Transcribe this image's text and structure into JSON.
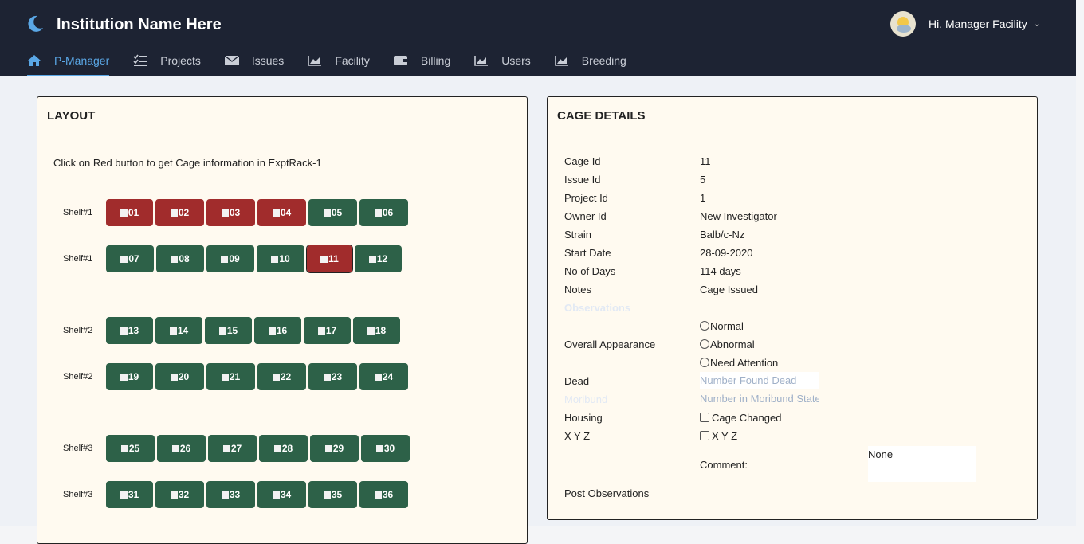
{
  "header": {
    "brand": "Institution Name Here",
    "greeting": "Hi, Manager Facility",
    "nav": [
      {
        "label": "P-Manager",
        "icon": "home-icon"
      },
      {
        "label": "Projects",
        "icon": "tasks-icon"
      },
      {
        "label": "Issues",
        "icon": "envelope-icon"
      },
      {
        "label": "Facility",
        "icon": "chart-icon"
      },
      {
        "label": "Billing",
        "icon": "wallet-icon"
      },
      {
        "label": "Users",
        "icon": "chart-icon"
      },
      {
        "label": "Breeding",
        "icon": "chart-icon"
      }
    ]
  },
  "layout": {
    "title": "LAYOUT",
    "hint": "Click on Red button to get Cage information in ExptRack-1",
    "shelves": [
      {
        "label": "Shelf#1",
        "cages": [
          [
            "01",
            "red"
          ],
          [
            "02",
            "red"
          ],
          [
            "03",
            "red"
          ],
          [
            "04",
            "red"
          ],
          [
            "05",
            "green"
          ],
          [
            "06",
            "green"
          ]
        ]
      },
      {
        "label": "Shelf#1",
        "cages": [
          [
            "07",
            "green"
          ],
          [
            "08",
            "green"
          ],
          [
            "09",
            "green"
          ],
          [
            "10",
            "green"
          ],
          [
            "11",
            "red"
          ],
          [
            "12",
            "green"
          ]
        ]
      },
      {
        "label": "Shelf#2",
        "cages": [
          [
            "13",
            "green"
          ],
          [
            "14",
            "green"
          ],
          [
            "15",
            "green"
          ],
          [
            "16",
            "green"
          ],
          [
            "17",
            "green"
          ],
          [
            "18",
            "green"
          ]
        ]
      },
      {
        "label": "Shelf#2",
        "cages": [
          [
            "19",
            "green"
          ],
          [
            "20",
            "green"
          ],
          [
            "21",
            "green"
          ],
          [
            "22",
            "green"
          ],
          [
            "23",
            "green"
          ],
          [
            "24",
            "green"
          ]
        ]
      },
      {
        "label": "Shelf#3",
        "cages": [
          [
            "25",
            "green"
          ],
          [
            "26",
            "green"
          ],
          [
            "27",
            "green"
          ],
          [
            "28",
            "green"
          ],
          [
            "29",
            "green"
          ],
          [
            "30",
            "green"
          ]
        ]
      },
      {
        "label": "Shelf#3",
        "cages": [
          [
            "31",
            "green"
          ],
          [
            "32",
            "green"
          ],
          [
            "33",
            "green"
          ],
          [
            "34",
            "green"
          ],
          [
            "35",
            "green"
          ],
          [
            "36",
            "green"
          ]
        ]
      }
    ]
  },
  "details": {
    "title": "CAGE DETAILS",
    "cage_id_label": "Cage Id",
    "cage_id": "11",
    "issue_id_label": "Issue Id",
    "issue_id": "5",
    "project_id_label": "Project Id",
    "project_id": "1",
    "owner_label": "Owner Id",
    "owner": "New Investigator",
    "strain_label": "Strain",
    "strain": "Balb/c-Nz",
    "start_label": "Start Date",
    "start": "28-09-2020",
    "days_label": "No of Days",
    "days": "114 days",
    "notes_label": "Notes",
    "notes": "Cage Issued",
    "observations_label": "Observations",
    "appearance_label": "Overall Appearance",
    "appearance_options": [
      "Normal",
      "Abnormal",
      "Need Attention"
    ],
    "dead_label": "Dead",
    "dead_placeholder": "Number Found Dead",
    "moribund_label": "Moribund",
    "moribund_placeholder": "Number in Moribund State",
    "housing_label": "Housing",
    "housing_option": "Cage Changed",
    "xyz_label": "X Y Z",
    "xyz_option": "X Y Z",
    "comment_label": "Comment:",
    "comment_value": "None",
    "post_label": "Post Observations"
  }
}
